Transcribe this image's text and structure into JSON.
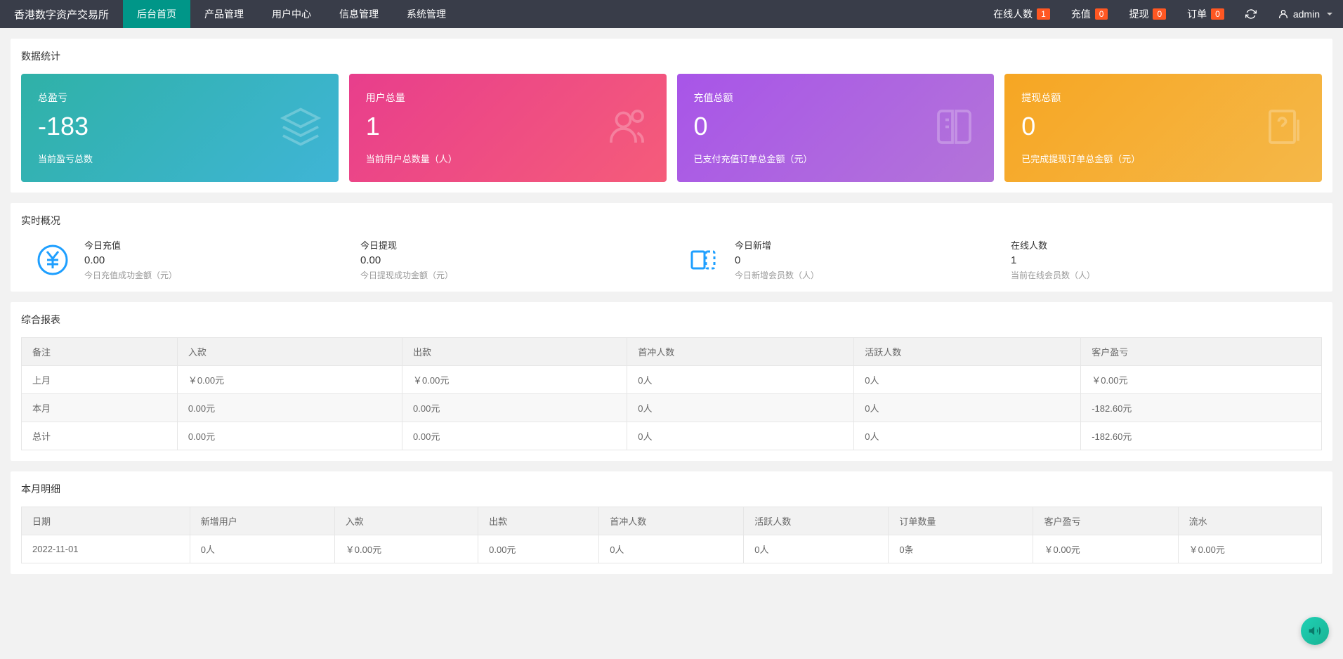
{
  "header": {
    "brand": "香港数字资产交易所",
    "nav": [
      "后台首页",
      "产品管理",
      "用户中心",
      "信息管理",
      "系统管理"
    ],
    "right": {
      "online_label": "在线人数",
      "online_count": "1",
      "deposit_label": "充值",
      "deposit_count": "0",
      "withdraw_label": "提现",
      "withdraw_count": "0",
      "order_label": "订单",
      "order_count": "0",
      "user": "admin"
    }
  },
  "stats": {
    "title": "数据统计",
    "cards": [
      {
        "label": "总盈亏",
        "value": "-183",
        "desc": "当前盈亏总数"
      },
      {
        "label": "用户总量",
        "value": "1",
        "desc": "当前用户总数量（人）"
      },
      {
        "label": "充值总额",
        "value": "0",
        "desc": "已支付充值订单总金额（元）"
      },
      {
        "label": "提现总额",
        "value": "0",
        "desc": "已完成提现订单总金额（元）"
      }
    ]
  },
  "realtime": {
    "title": "实时概况",
    "items": [
      {
        "label": "今日充值",
        "value": "0.00",
        "desc": "今日充值成功金额（元）"
      },
      {
        "label": "今日提现",
        "value": "0.00",
        "desc": "今日提现成功金额（元）"
      },
      {
        "label": "今日新增",
        "value": "0",
        "desc": "今日新增会员数（人）"
      },
      {
        "label": "在线人数",
        "value": "1",
        "desc": "当前在线会员数（人）"
      }
    ]
  },
  "report": {
    "title": "综合报表",
    "headers": [
      "备注",
      "入款",
      "出款",
      "首冲人数",
      "活跃人数",
      "客户盈亏"
    ],
    "rows": [
      [
        "上月",
        "￥0.00元",
        "￥0.00元",
        "0人",
        "0人",
        "￥0.00元"
      ],
      [
        "本月",
        "0.00元",
        "0.00元",
        "0人",
        "0人",
        "-182.60元"
      ],
      [
        "总计",
        "0.00元",
        "0.00元",
        "0人",
        "0人",
        "-182.60元"
      ]
    ]
  },
  "monthly": {
    "title": "本月明细",
    "headers": [
      "日期",
      "新增用户",
      "入款",
      "出款",
      "首冲人数",
      "活跃人数",
      "订单数量",
      "客户盈亏",
      "流水"
    ],
    "rows": [
      [
        "2022-11-01",
        "0人",
        "￥0.00元",
        "0.00元",
        "0人",
        "0人",
        "0条",
        "￥0.00元",
        "￥0.00元"
      ]
    ]
  }
}
